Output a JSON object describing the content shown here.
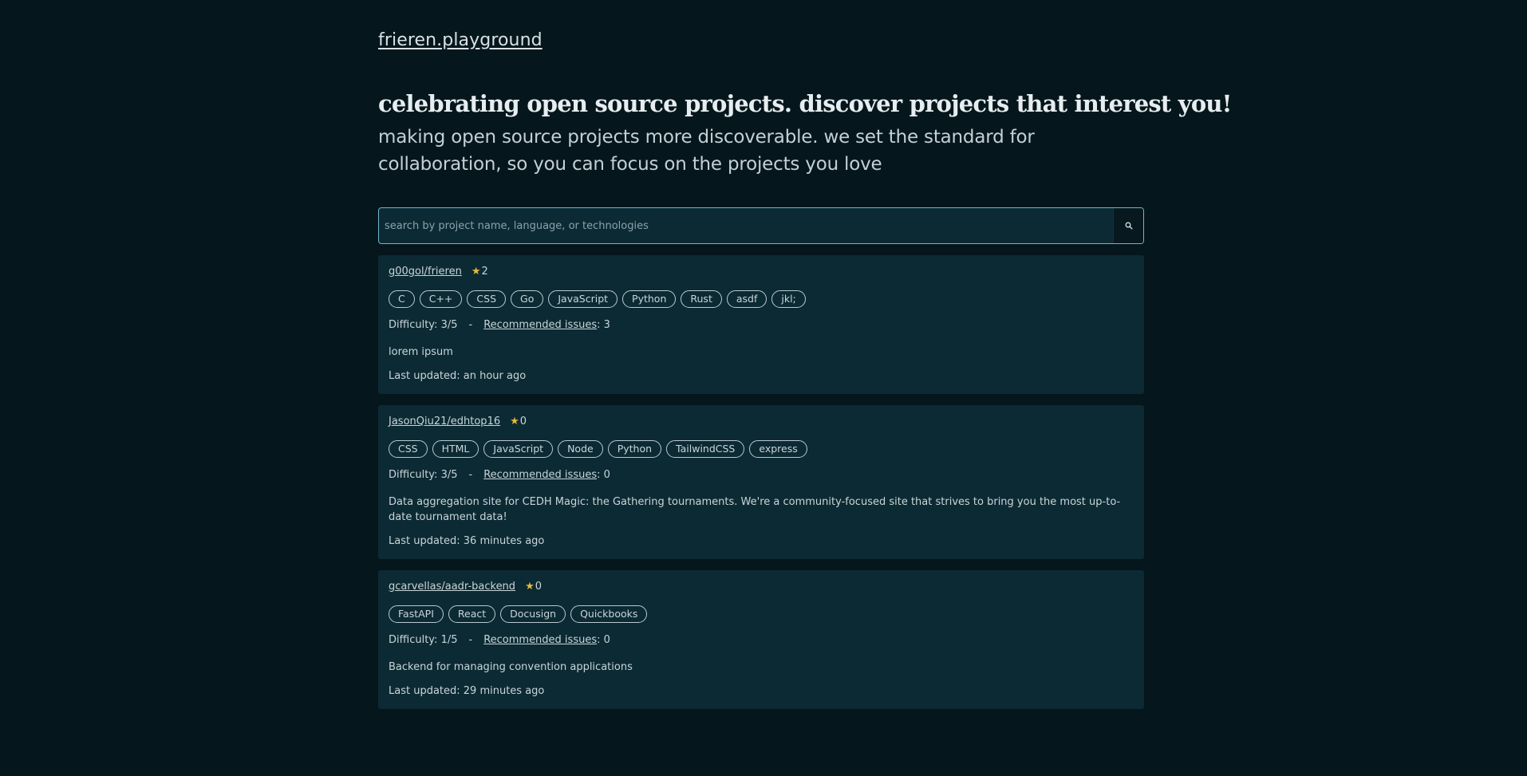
{
  "header": {
    "brand": "frieren.playground"
  },
  "hero": {
    "headline": "celebrating open source projects. discover projects that interest you!",
    "subhead": "making open source projects more discoverable. we set the standard for collaboration, so you can focus on the projects you love"
  },
  "search": {
    "placeholder": "search by project name, language, or technologies",
    "button_icon": "search-icon"
  },
  "projects": [
    {
      "name": "g00gol/frieren",
      "stars": "2",
      "tags": [
        "C",
        "C++",
        "CSS",
        "Go",
        "JavaScript",
        "Python",
        "Rust",
        "asdf",
        "jkl;"
      ],
      "difficulty_label": "Difficulty:",
      "difficulty": "3/5",
      "separator": "-",
      "issues_label": "Recommended issues",
      "issues_count": ": 3",
      "description": "lorem ipsum",
      "updated": "Last updated: an hour ago"
    },
    {
      "name": "JasonQiu21/edhtop16",
      "stars": "0",
      "tags": [
        "CSS",
        "HTML",
        "JavaScript",
        "Node",
        "Python",
        "TailwindCSS",
        "express"
      ],
      "difficulty_label": "Difficulty:",
      "difficulty": "3/5",
      "separator": "-",
      "issues_label": "Recommended issues",
      "issues_count": ": 0",
      "description": "Data aggregation site for CEDH Magic: the Gathering tournaments. We're a community-focused site that strives to bring you the most up-to-date tournament data!",
      "updated": "Last updated: 36 minutes ago"
    },
    {
      "name": "gcarvellas/aadr-backend",
      "stars": "0",
      "tags": [
        "FastAPI",
        "React",
        "Docusign",
        "Quickbooks"
      ],
      "difficulty_label": "Difficulty:",
      "difficulty": "1/5",
      "separator": "-",
      "issues_label": "Recommended issues",
      "issues_count": ": 0",
      "description": "Backend for managing convention applications",
      "updated": "Last updated: 29 minutes ago"
    }
  ],
  "colors": {
    "background": "#06161d",
    "card": "#0c2a33",
    "search_border": "#6fb7c6",
    "star": "#e8b93a"
  }
}
